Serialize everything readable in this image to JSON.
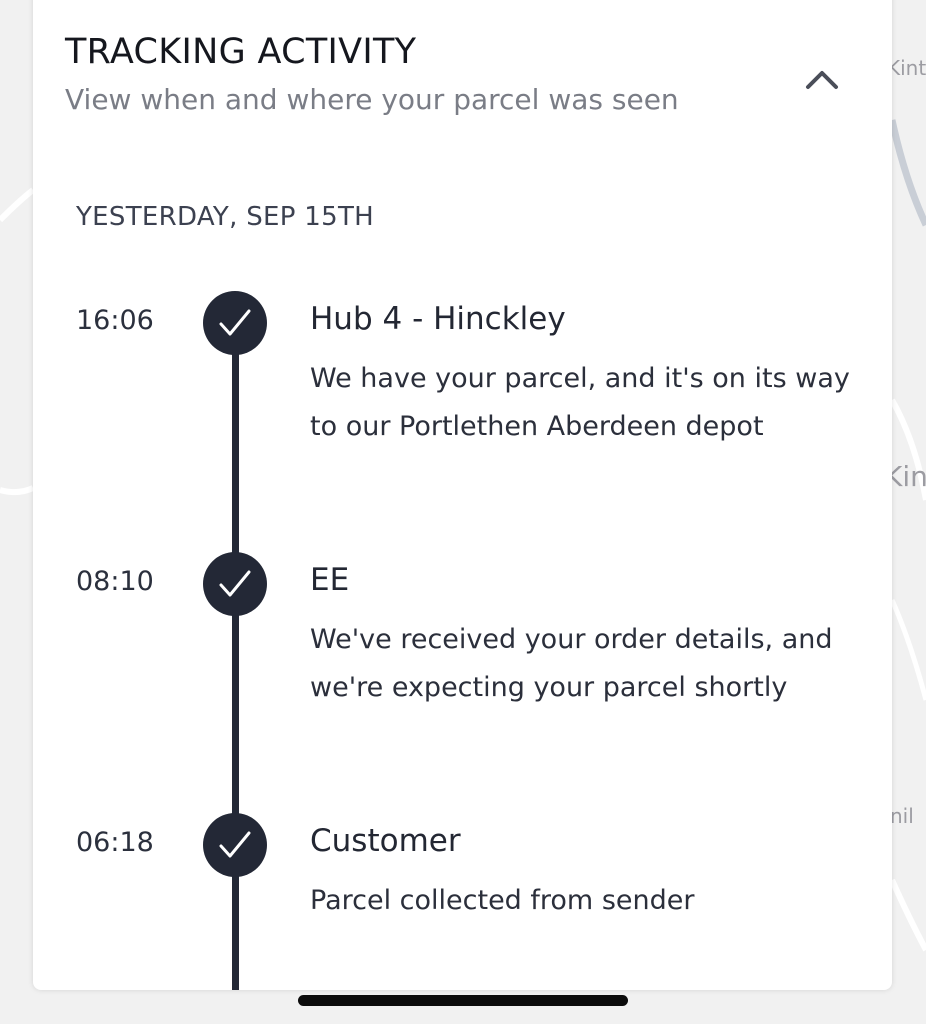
{
  "map": {
    "labels": [
      "Kint",
      "Kin",
      "nil"
    ]
  },
  "tracking": {
    "title": "TRACKING ACTIVITY",
    "subtitle": "View when and where your parcel was seen",
    "collapse_icon": "chevron-up-icon",
    "date_header": "YESTERDAY, SEP 15TH",
    "events": [
      {
        "time": "16:06",
        "title": "Hub 4 - Hinckley",
        "description": "We have your parcel, and it's on its way to our Portlethen Aberdeen depot",
        "icon": "checkmark-icon"
      },
      {
        "time": "08:10",
        "title": "EE",
        "description": "We've received your order details, and we're expecting your parcel shortly",
        "icon": "checkmark-icon"
      },
      {
        "time": "06:18",
        "title": "Customer",
        "description": "Parcel collected from sender",
        "icon": "checkmark-icon"
      }
    ]
  },
  "colors": {
    "accent_dark": "#232836",
    "subtitle_gray": "#7a7d86",
    "background": "#f1f1f1"
  }
}
